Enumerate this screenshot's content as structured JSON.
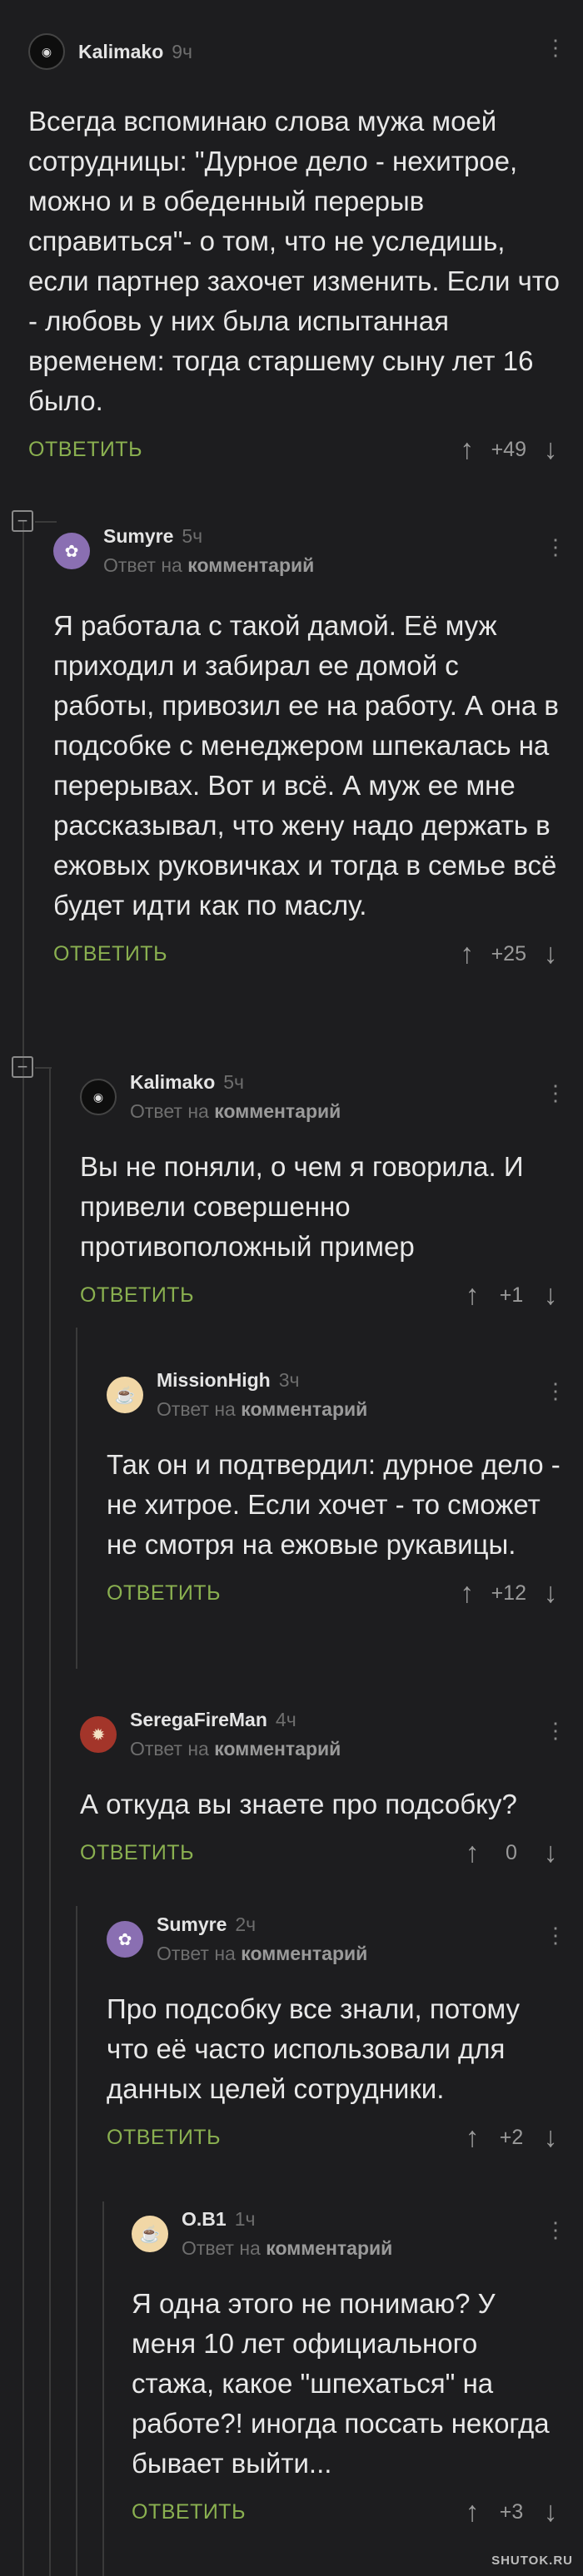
{
  "ui": {
    "reply_prefix": "Ответ на",
    "reply_target": "комментарий",
    "reply_button": "ОТВЕТИТЬ",
    "more_icon": "⋮",
    "collapse_icon": "−",
    "upvote_icon": "↑",
    "downvote_icon": "↓"
  },
  "comments": [
    {
      "author": "Kalimako",
      "time": "9ч",
      "avatar_glyph": "◉",
      "text": "Всегда вспоминаю слова мужа моей сотрудницы: \"Дурное дело - нехитрое, можно и в обеденный перерыв справиться\"- о том, что не уследишь, если партнер захочет изменить. Если что - любовь у них была испытанная временем: тогда старшему сыну лет 16 было.",
      "rating": "+49"
    },
    {
      "author": "Sumyre",
      "time": "5ч",
      "avatar_glyph": "✿",
      "text": "Я работала с такой дамой. Её муж приходил и забирал ее домой с работы, привозил ее на работу. А она в подсобке с менеджером шпекалась на перерывах. Вот и всё. А муж ее мне рассказывал, что жену надо держать в ежовых руковичках и тогда в семье всё будет идти как по маслу.",
      "rating": "+25"
    },
    {
      "author": "Kalimako",
      "time": "5ч",
      "avatar_glyph": "◉",
      "text": "Вы не поняли, о чем я говорила. И привели совершенно противоположный пример",
      "rating": "+1"
    },
    {
      "author": "MissionHigh",
      "time": "3ч",
      "avatar_glyph": "☕",
      "text": "Так он и подтвердил: дурное дело - не хитрое. Если хочет - то сможет не смотря на ежовые рукавицы.",
      "rating": "+12"
    },
    {
      "author": "SeregaFireMan",
      "time": "4ч",
      "avatar_glyph": "✹",
      "text": "А откуда вы знаете про подсобку?",
      "rating": "0"
    },
    {
      "author": "Sumyre",
      "time": "2ч",
      "avatar_glyph": "✿",
      "text": "Про подсобку все знали, потому что её часто использовали для данных целей сотрудники.",
      "rating": "+2"
    },
    {
      "author": "O.B1",
      "time": "1ч",
      "avatar_glyph": "☕",
      "text": "Я одна этого не понимаю? У меня 10 лет официального стажа, какое \"шпехаться\" на работе?! иногда поссать некогда бывает выйти...",
      "rating": "+3"
    }
  ],
  "watermark": "SHUTOK.RU"
}
